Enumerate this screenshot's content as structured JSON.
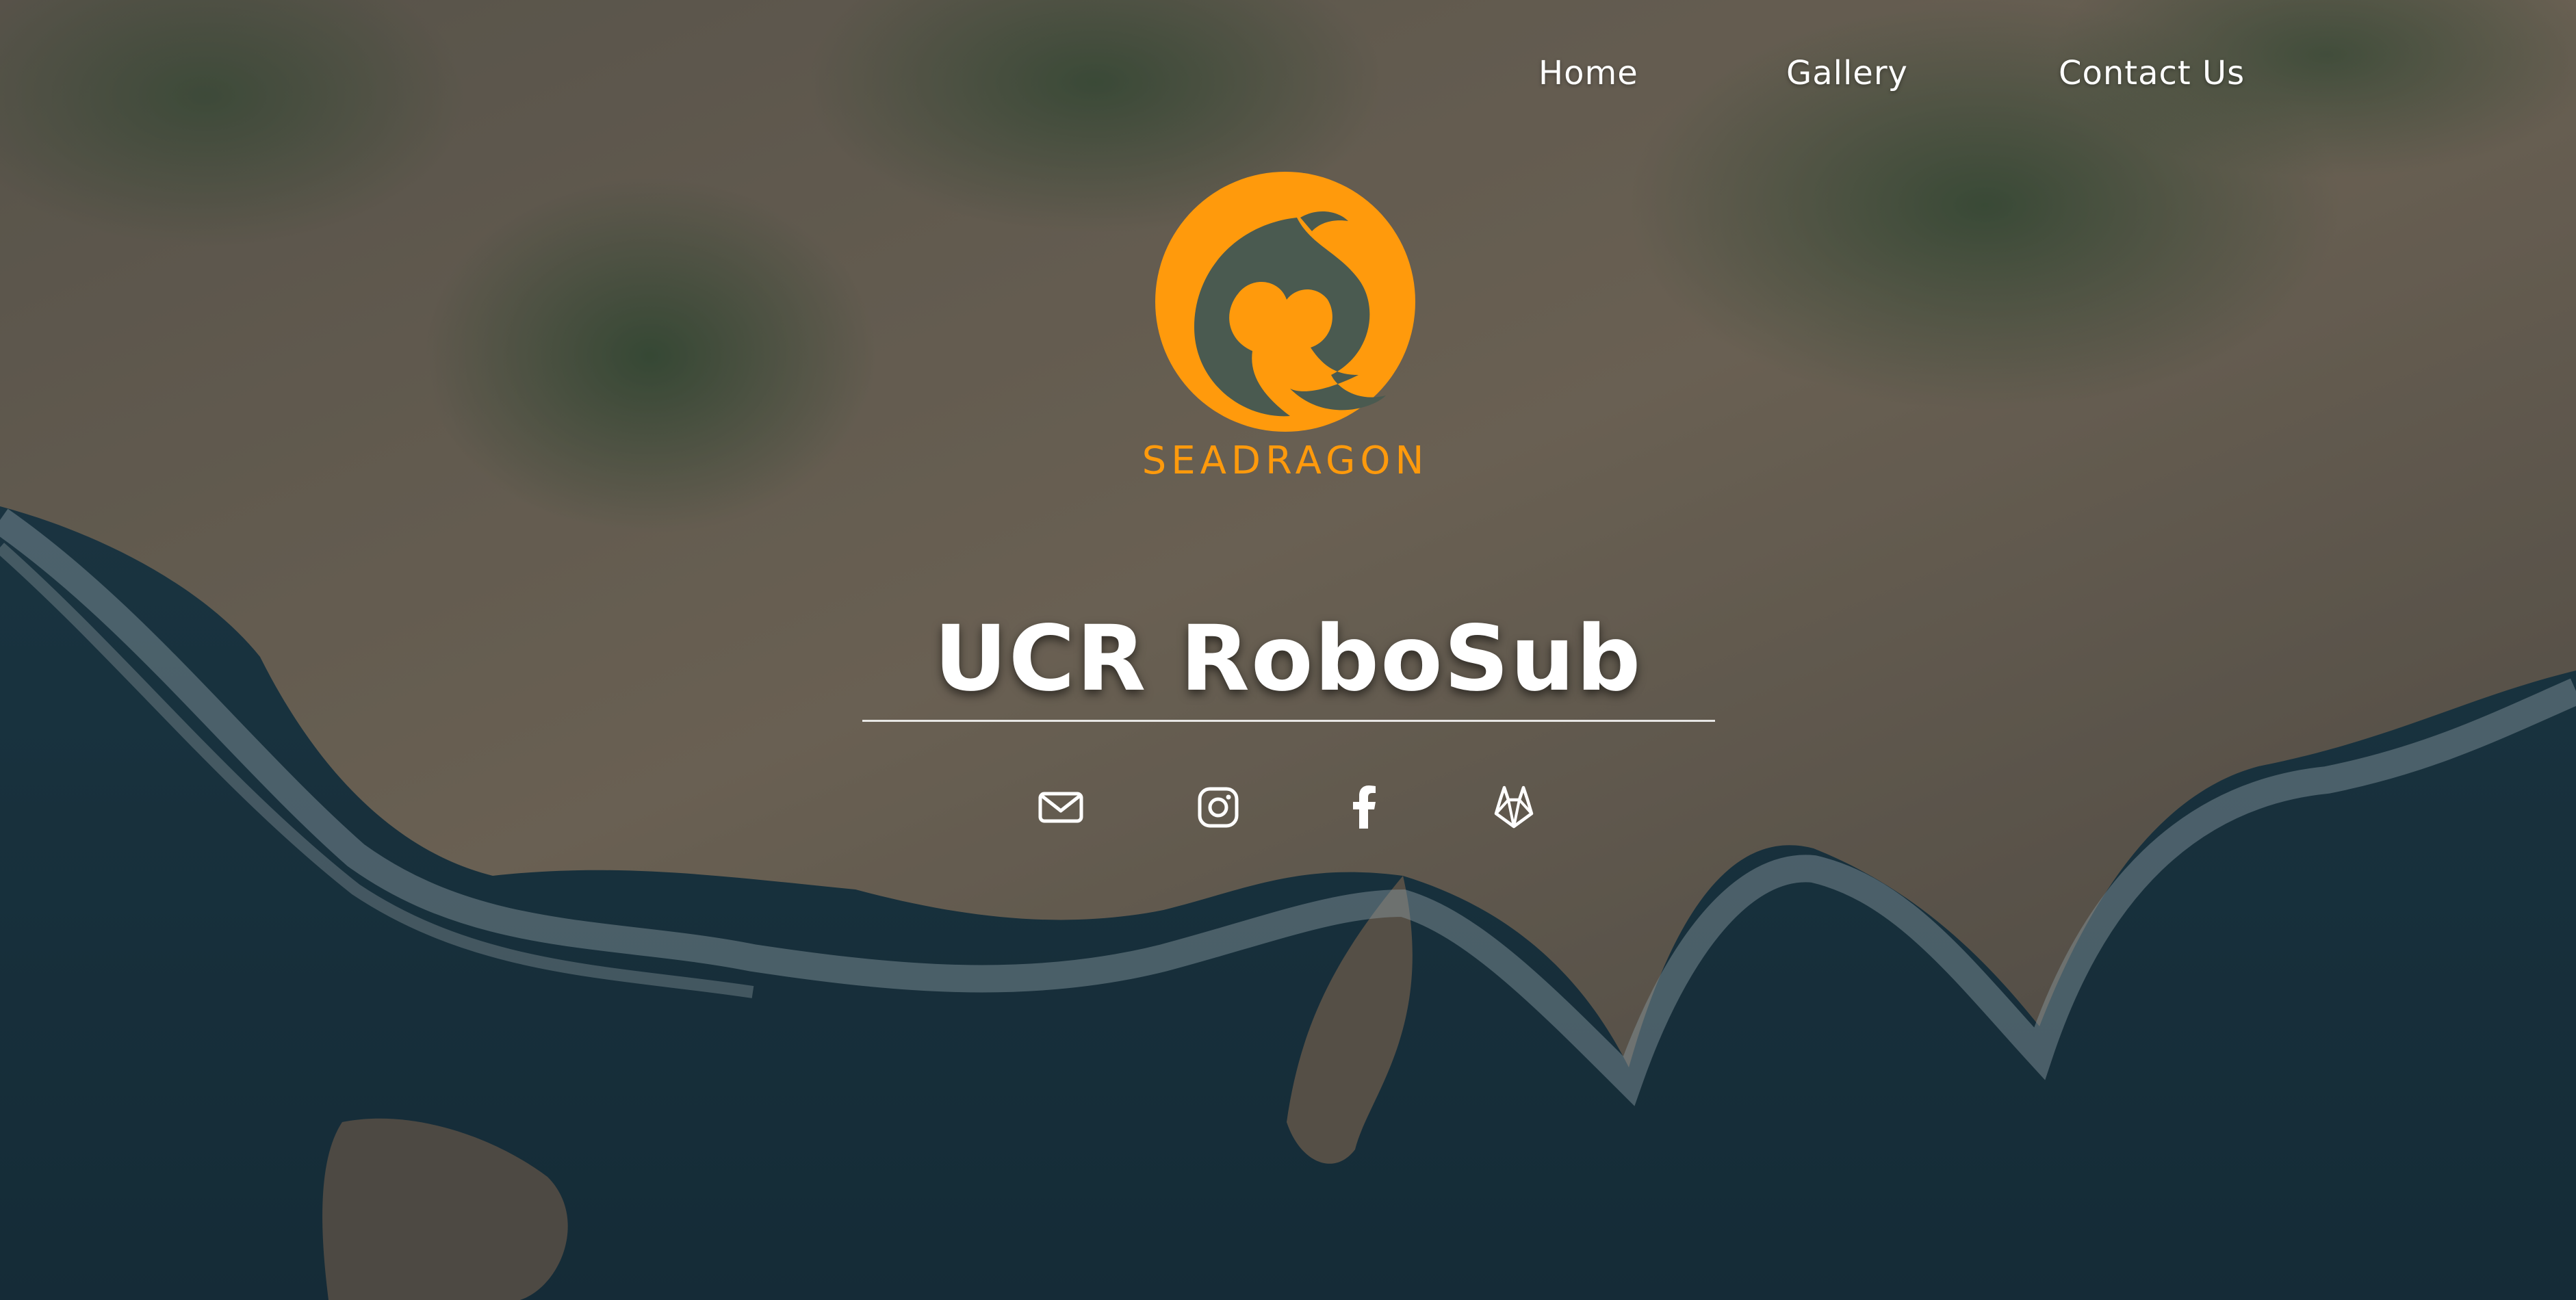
{
  "nav": {
    "items": [
      {
        "label": "Home"
      },
      {
        "label": "Gallery"
      },
      {
        "label": "Contact Us"
      }
    ]
  },
  "logo": {
    "icon": "seadragon-logo",
    "wordmark": "SEADRAGON",
    "color": "#FF9A0C"
  },
  "hero": {
    "title": "UCR RoboSub"
  },
  "social": [
    {
      "icon": "mail-icon"
    },
    {
      "icon": "instagram-icon"
    },
    {
      "icon": "facebook-icon"
    },
    {
      "icon": "gitlab-icon"
    }
  ],
  "colors": {
    "accent": "#FF9A0C",
    "text": "#FFFFFF",
    "ocean": "#1D3A47",
    "rock": "#8C7A62"
  }
}
